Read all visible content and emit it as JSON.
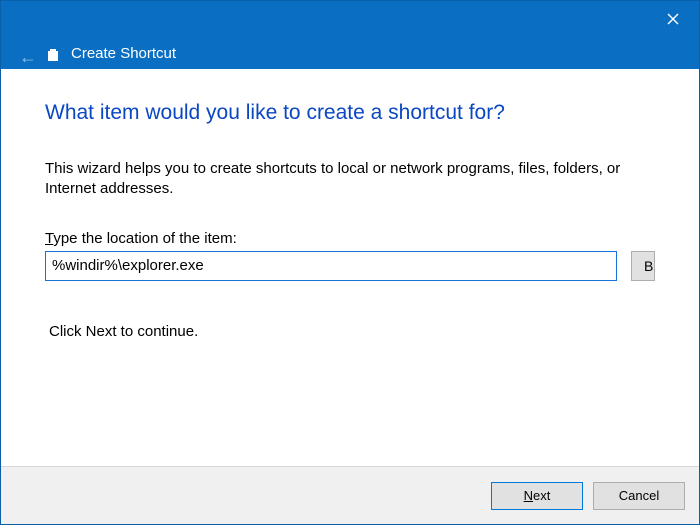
{
  "window": {
    "title": "Create Shortcut"
  },
  "main": {
    "heading": "What item would you like to create a shortcut for?",
    "description": "This wizard helps you to create shortcuts to local or network programs, files, folders, or Internet addresses.",
    "location_label_pre": "T",
    "location_label_rest": "ype the location of the item:",
    "location_value": "%windir%\\explorer.exe",
    "browse_label_pre": "B",
    "browse_label_rest": "rowse...",
    "continue_text": "Click Next to continue."
  },
  "footer": {
    "next_pre": "N",
    "next_rest": "ext",
    "cancel": "Cancel"
  }
}
